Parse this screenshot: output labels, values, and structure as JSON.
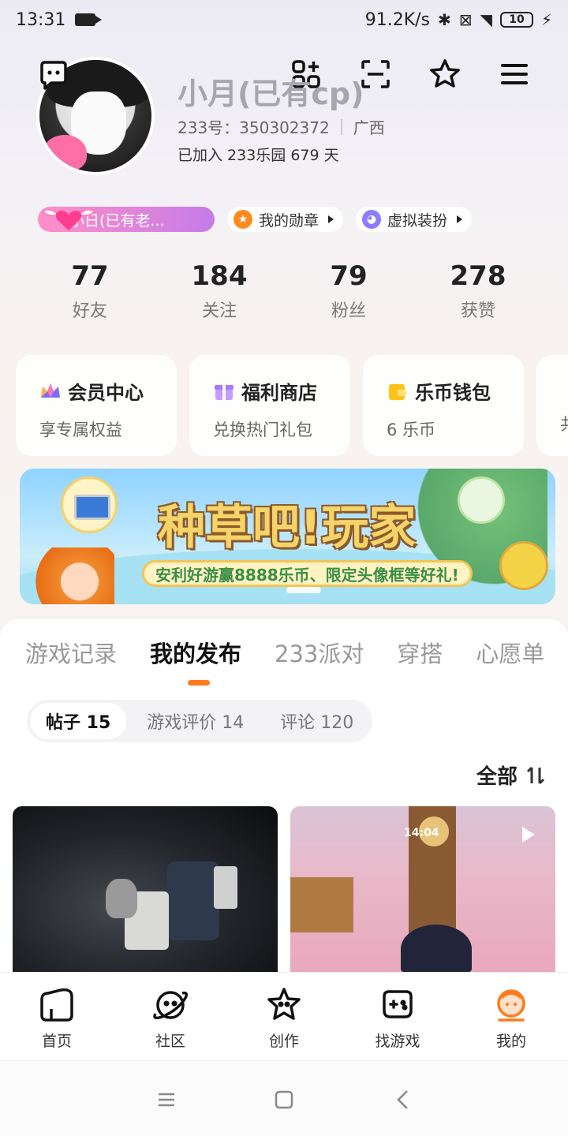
{
  "status_bar": {
    "time": "13:31",
    "network_speed": "91.2K/s",
    "battery": "10"
  },
  "profile": {
    "username": "小月(已有cp)",
    "id_label": "233号：350302372",
    "region": "广西",
    "joined": "已加入 233乐园 679 天"
  },
  "chips": {
    "title_chip": "小日(已有老...",
    "medals": "我的勋章",
    "dressup": "虚拟装扮"
  },
  "stats": [
    {
      "num": "77",
      "label": "好友"
    },
    {
      "num": "184",
      "label": "关注"
    },
    {
      "num": "79",
      "label": "粉丝"
    },
    {
      "num": "278",
      "label": "获赞"
    }
  ],
  "cards": [
    {
      "title": "会员中心",
      "sub": "享专属权益"
    },
    {
      "title": "福利商店",
      "sub": "兑换热门礼包"
    },
    {
      "title": "乐币钱包",
      "sub": "6 乐币"
    },
    {
      "title": "",
      "sub": "共"
    }
  ],
  "banner": {
    "title": "种草吧!玩家",
    "subtitle": "安利好游赢8888乐币、限定头像框等好礼!"
  },
  "tabs": [
    "游戏记录",
    "我的发布",
    "233派对",
    "穿搭",
    "心愿单"
  ],
  "subtabs": [
    "帖子 15",
    "游戏评价 14",
    "评论 120"
  ],
  "sort_label": "全部",
  "post_game": {
    "timer": "14:04"
  },
  "bottom_nav": [
    "首页",
    "社区",
    "创作",
    "找游戏",
    "我的"
  ],
  "colors": {
    "accent": "#ff7a1a",
    "text": "#222222",
    "muted": "#999999"
  }
}
